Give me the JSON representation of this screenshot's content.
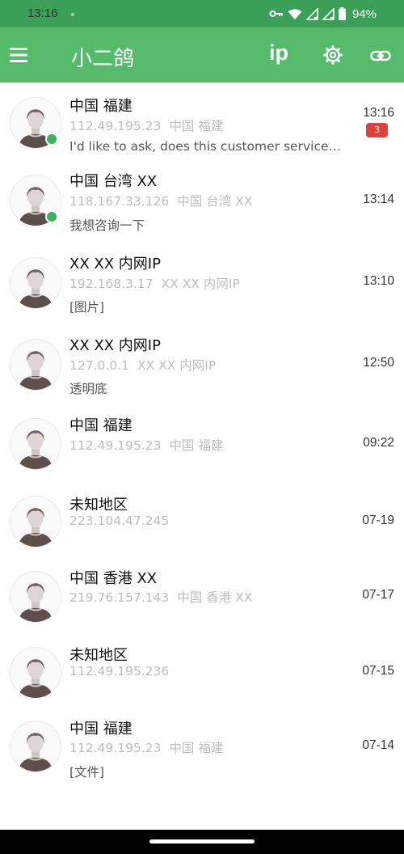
{
  "status_bar": {
    "time": "13:16",
    "battery": "94%",
    "icons": [
      "key-icon",
      "wifi-icon",
      "signal-icon",
      "signal-icon",
      "battery-icon"
    ]
  },
  "app_bar": {
    "title": "小二鸽",
    "ip_label": "ip",
    "menu_icon": "menu-icon",
    "settings_icon": "gear-icon",
    "link_icon": "link-icon",
    "color": "#55bb6a",
    "status_color": "#3a9f57"
  },
  "conversations": [
    {
      "name": "中国 福建",
      "ip": "112.49.195.23",
      "location": "中国 福建",
      "message": "I'd like to ask, does this customer service system support file transfer?",
      "time": "13:16",
      "unread": "3",
      "online": true
    },
    {
      "name": "中国 台湾 XX",
      "ip": "118.167.33.126",
      "location": "中国 台湾 XX",
      "message": "我想咨询一下",
      "time": "13:14",
      "unread": "",
      "online": true
    },
    {
      "name": "XX XX 内网IP",
      "ip": "192.168.3.17",
      "location": "XX XX 内网IP",
      "message": "[图片]",
      "time": "13:10",
      "unread": "",
      "online": false
    },
    {
      "name": "XX XX 内网IP",
      "ip": "127.0.0.1",
      "location": "XX XX 内网IP",
      "message": "透明底",
      "time": "12:50",
      "unread": "",
      "online": false
    },
    {
      "name": "中国 福建",
      "ip": "112.49.195.23",
      "location": "中国 福建",
      "message": "",
      "time": "09:22",
      "unread": "",
      "online": false
    },
    {
      "name": "未知地区",
      "ip": "223.104.47.245",
      "location": "",
      "message": "",
      "time": "07-19",
      "unread": "",
      "online": false
    },
    {
      "name": "中国 香港 XX",
      "ip": "219.76.157.143",
      "location": "中国 香港 XX",
      "message": "",
      "time": "07-17",
      "unread": "",
      "online": false
    },
    {
      "name": "未知地区",
      "ip": "112.49.195.236",
      "location": "",
      "message": "",
      "time": "07-15",
      "unread": "",
      "online": false
    },
    {
      "name": "中国 福建",
      "ip": "112.49.195.23",
      "location": "中国 福建",
      "message": "[文件]",
      "time": "07-14",
      "unread": "",
      "online": false
    }
  ],
  "colors": {
    "online_dot": "#3bb35a",
    "badge": "#e0413b",
    "subtext": "#bdbdbd"
  }
}
